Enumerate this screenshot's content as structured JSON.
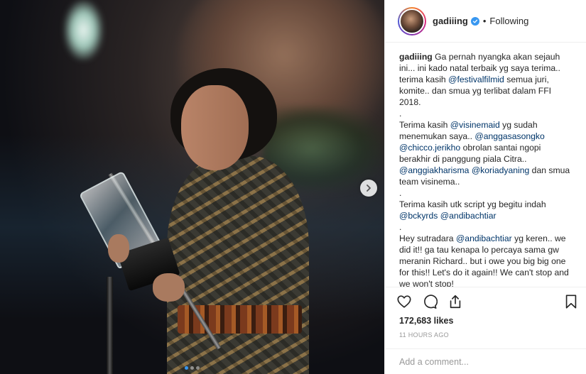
{
  "post": {
    "username": "gadiiing",
    "follow_status": "Following",
    "bullet": "•",
    "caption_lines": [
      [
        {
          "t": "gadiiing",
          "k": "author"
        },
        {
          "t": " Ga pernah nyangka akan sejauh ini... ini kado natal terbaik yg saya terima.. terima kasih "
        },
        {
          "t": "@festivalfilmid",
          "k": "mention"
        },
        {
          "t": " semua juri, komite.. dan smua yg terlibat dalam FFI 2018."
        }
      ],
      [
        {
          "t": "."
        }
      ],
      [
        {
          "t": "Terima kasih "
        },
        {
          "t": "@visinemaid",
          "k": "mention"
        },
        {
          "t": " yg sudah menemukan saya.. "
        },
        {
          "t": "@anggasasongko",
          "k": "mention"
        },
        {
          "t": " "
        },
        {
          "t": "@chicco.jerikho",
          "k": "mention"
        },
        {
          "t": " obrolan santai ngopi berakhir di panggung piala Citra.. "
        },
        {
          "t": "@anggiakharisma",
          "k": "mention"
        },
        {
          "t": " "
        },
        {
          "t": "@koriadyaning",
          "k": "mention"
        },
        {
          "t": " dan smua team visinema.."
        }
      ],
      [
        {
          "t": "."
        }
      ],
      [
        {
          "t": "Terima kasih utk script yg begitu indah "
        },
        {
          "t": "@bckyrds",
          "k": "mention"
        },
        {
          "t": " "
        },
        {
          "t": "@andibachtiar",
          "k": "mention"
        }
      ],
      [
        {
          "t": "."
        }
      ],
      [
        {
          "t": "Hey sutradara "
        },
        {
          "t": "@andibachtiar",
          "k": "mention"
        },
        {
          "t": " yg keren.. we did it!! ga tau kenapa lo percaya sama gw meranin Richard.. but i owe you big big one for this!! Let's do it again!! We can't stop and we won't stop!"
        }
      ]
    ],
    "likes": "172,683 likes",
    "time": "11 HOURS AGO",
    "comment_placeholder": "Add a comment...",
    "carousel": {
      "count": 3,
      "active": 0
    }
  },
  "icons": {
    "verified": "verified-badge-icon",
    "like": "heart-icon",
    "comment": "comment-bubble-icon",
    "share": "share-icon",
    "save": "bookmark-icon",
    "next": "chevron-right-icon"
  },
  "colors": {
    "mention": "#003569",
    "verified": "#3897f0",
    "muted": "#999999",
    "text": "#262626"
  }
}
